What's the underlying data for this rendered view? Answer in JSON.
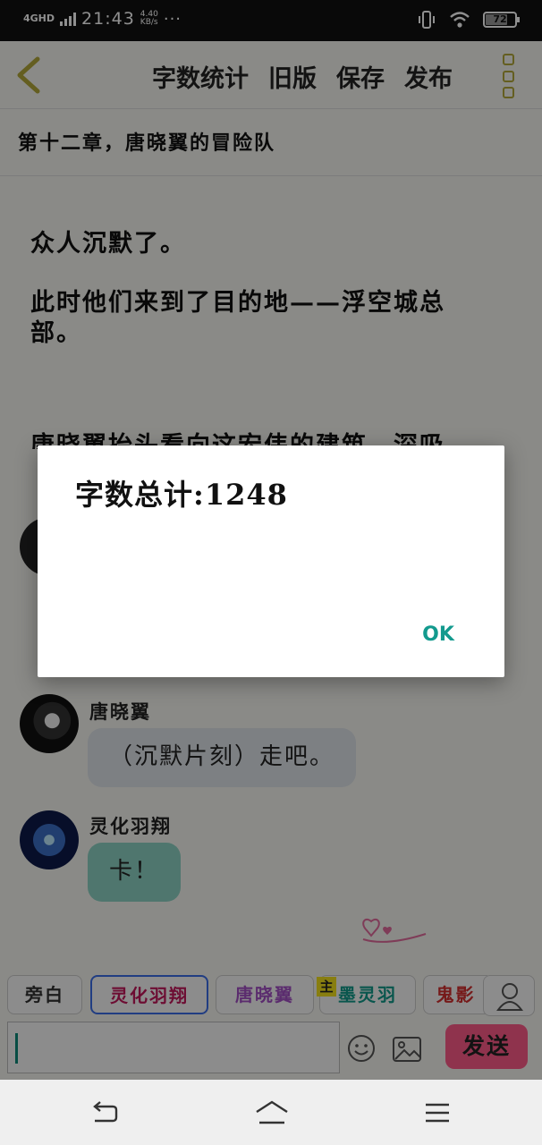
{
  "status_bar": {
    "network": "4GHD",
    "time": "21:43",
    "speed_value": "4.40",
    "speed_unit": "KB/s",
    "more": "···",
    "battery": "72"
  },
  "toolbar": {
    "actions": [
      "字数统计",
      "旧版",
      "保存",
      "发布"
    ],
    "accent_color": "#b3a83a"
  },
  "chapter": {
    "title": "第十二章，唐晓翼的冒险队"
  },
  "story": {
    "paragraphs": [
      "众人沉默了。",
      "此时他们来到了目的地——浮空城总部。",
      "唐晓翼抬头看向这宏伟的建筑，深吸"
    ]
  },
  "messages": [
    {
      "speaker": "唐晓翼",
      "text": "（沉默片刻）走吧。",
      "bubble_color": "#dfe4ea"
    },
    {
      "speaker": "灵化羽翔",
      "text": "卡！",
      "bubble_color": "#8ed3c4"
    }
  ],
  "role_tabs": [
    {
      "label": "旁白",
      "color": "#333333"
    },
    {
      "label": "灵化羽翔",
      "color": "#c2185b"
    },
    {
      "label": "唐晓翼",
      "color": "#a24fc4"
    },
    {
      "label": "墨灵羽",
      "color": "#11998a"
    },
    {
      "label": "鬼影",
      "color": "#d32f2f"
    }
  ],
  "main_badge": "主",
  "input": {
    "value": ""
  },
  "send_label": "发送",
  "dialog": {
    "message": "字数总计:1248",
    "ok_label": "OK"
  }
}
